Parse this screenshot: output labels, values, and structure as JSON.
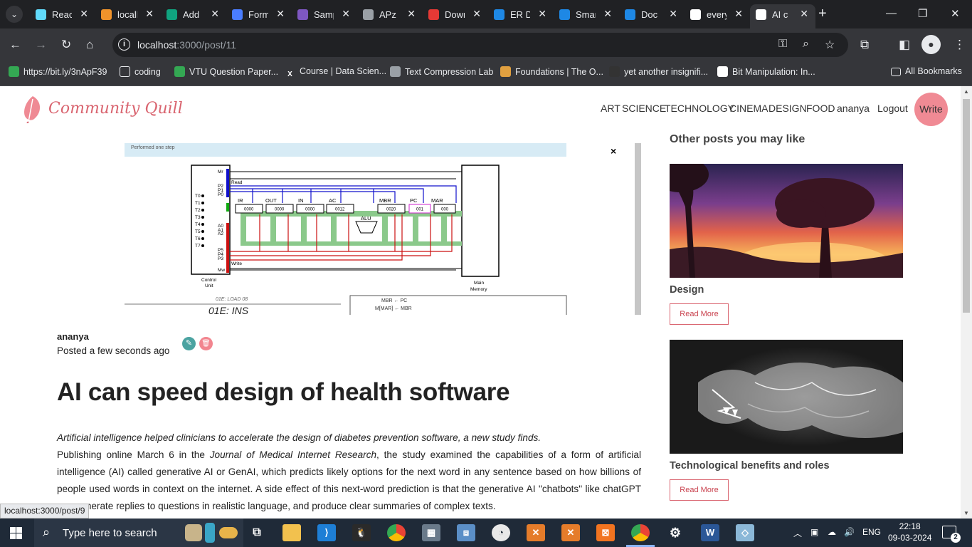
{
  "browser": {
    "tabs": [
      {
        "title": "React",
        "icon": "react-icon",
        "color": "#61dafb",
        "active": false
      },
      {
        "title": "localhost",
        "icon": "xampp-icon",
        "color": "#f0932b",
        "active": false
      },
      {
        "title": "Add",
        "icon": "chatgpt-icon",
        "color": "#10a37f",
        "active": false
      },
      {
        "title": "Form",
        "icon": "flag-icon",
        "color": "#4a7dff",
        "active": false
      },
      {
        "title": "Sample",
        "icon": "form-icon",
        "color": "#7e57c2",
        "active": false
      },
      {
        "title": "APz",
        "icon": "globe-icon",
        "color": "#9aa0a6",
        "active": false
      },
      {
        "title": "Download",
        "icon": "heart-icon",
        "color": "#e53935",
        "active": false
      },
      {
        "title": "ER D",
        "icon": "diagram-icon",
        "color": "#1e88e5",
        "active": false
      },
      {
        "title": "Smart",
        "icon": "diagram-icon",
        "color": "#1e88e5",
        "active": false
      },
      {
        "title": "Doc",
        "icon": "diagram-icon",
        "color": "#1e88e5",
        "active": false
      },
      {
        "title": "every",
        "icon": "google-icon",
        "color": "#ffffff",
        "active": false
      },
      {
        "title": "AI c",
        "icon": "sd-icon",
        "color": "#ffffff",
        "active": true
      }
    ],
    "url_host": "localhost",
    "url_path": ":3000/post/11",
    "bookmarks": [
      {
        "label": "https://bit.ly/3nApF39",
        "icon": "drive-icon"
      },
      {
        "label": "coding",
        "icon": "folder-icon"
      },
      {
        "label": "VTU Question Paper...",
        "icon": "drive-icon"
      },
      {
        "label": "Course | Data Scien...",
        "icon": "x-icon"
      },
      {
        "label": "Text Compression Lab",
        "icon": "globe-icon"
      },
      {
        "label": "Foundations | The O...",
        "icon": "owl-icon"
      },
      {
        "label": "yet another insignifi...",
        "icon": "terminal-icon"
      },
      {
        "label": "Bit Manipulation: In...",
        "icon": "dots-icon"
      }
    ],
    "all_bookmarks": "All Bookmarks",
    "status_link": "localhost:3000/post/9"
  },
  "site": {
    "logo": "Community Quill",
    "nav": [
      "ART",
      "SCIENCE",
      "TECHNOLOGY",
      "CINEMA",
      "DESIGN",
      "FOOD"
    ],
    "user": "ananya",
    "logout": "Logout",
    "write": "Write"
  },
  "post": {
    "author": "ananya",
    "posted": "Posted a few seconds ago",
    "title": "AI can speed design of health software",
    "lead": "Artificial intelligence helped clinicians to accelerate the design of diabetes prevention software, a new study finds.",
    "body_pre": "Publishing online March 6 in the ",
    "body_journal": "Journal of Medical Internet Research",
    "body_post": ", the study examined the capabilities of a form of artificial intelligence (AI) called generative AI or GenAI, which predicts likely options for the next word in any sentence based on how billions of people used words in context on the internet. A side effect of this next-word prediction is that the generative AI \"chatbots\" like chatGPT can generate replies to questions in realistic language, and produce clear summaries of complex texts."
  },
  "post_image": {
    "banner": "Performed one step",
    "labels": {
      "mr": "Mr",
      "read": "Read",
      "write": "Write",
      "mw": "Mw",
      "p2": "P2",
      "p1": "P1",
      "p0": "P0",
      "a0": "A0",
      "a1": "A1",
      "a2": "A2",
      "p5": "P5",
      "p4": "P4",
      "p3": "P3",
      "t": [
        "T0",
        "T1",
        "T2",
        "T3",
        "T4",
        "T5",
        "T6",
        "T7"
      ],
      "control_unit": "Control",
      "control_unit2": "Unit",
      "main_memory": "Main",
      "main_memory2": "Memory",
      "alu": "ALU",
      "registers": [
        {
          "name": "IR",
          "value": "0000"
        },
        {
          "name": "OUT",
          "value": "0000"
        },
        {
          "name": "IN",
          "value": "0000"
        },
        {
          "name": "AC",
          "value": "0012"
        },
        {
          "name": "MBR",
          "value": "0020"
        },
        {
          "name": "PC",
          "value": "001"
        },
        {
          "name": "MAR",
          "value": "000"
        }
      ],
      "code_small": "01E: LOAD 08",
      "code_big": "01E: INS",
      "rtl1": "MBR ← PC",
      "rtl2": "M[MAR] ← MBR"
    },
    "close": "×"
  },
  "sidebar": {
    "heading": "Other posts you may like",
    "posts": [
      {
        "caption": "Design",
        "read_more": "Read More"
      },
      {
        "caption": "Technological benefits and roles",
        "read_more": "Read More"
      }
    ]
  },
  "taskbar": {
    "search_placeholder": "Type here to search",
    "lang": "ENG",
    "time": "22:18",
    "date": "09-03-2024",
    "notifications": "2"
  }
}
